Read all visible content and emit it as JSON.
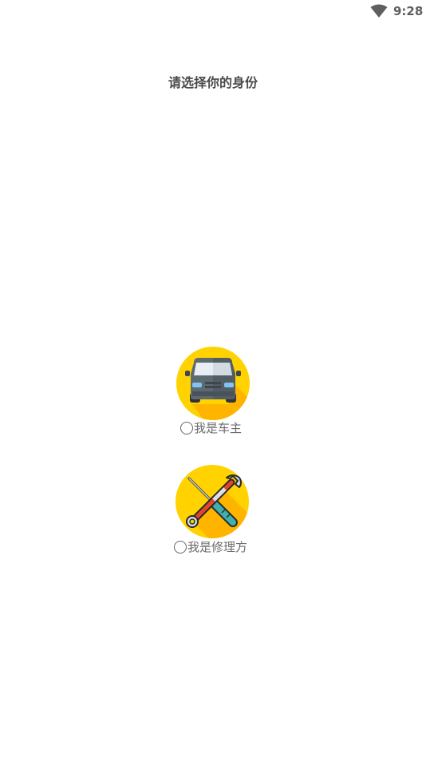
{
  "status_bar": {
    "time": "9:28",
    "wifi_icon": "wifi-icon"
  },
  "page": {
    "title": "请选择你的身份"
  },
  "roles": [
    {
      "label": "我是车主",
      "icon": "car-icon",
      "selected": false
    },
    {
      "label": "我是修理方",
      "icon": "repair-tools-icon",
      "selected": false
    }
  ],
  "colors": {
    "icon_bg_yellow": "#FFD200",
    "icon_shadow": "#FFB400",
    "car_body": "#5E6A72",
    "wrench_teal": "#3FB0B0",
    "screwdriver_red": "#E2462D"
  }
}
